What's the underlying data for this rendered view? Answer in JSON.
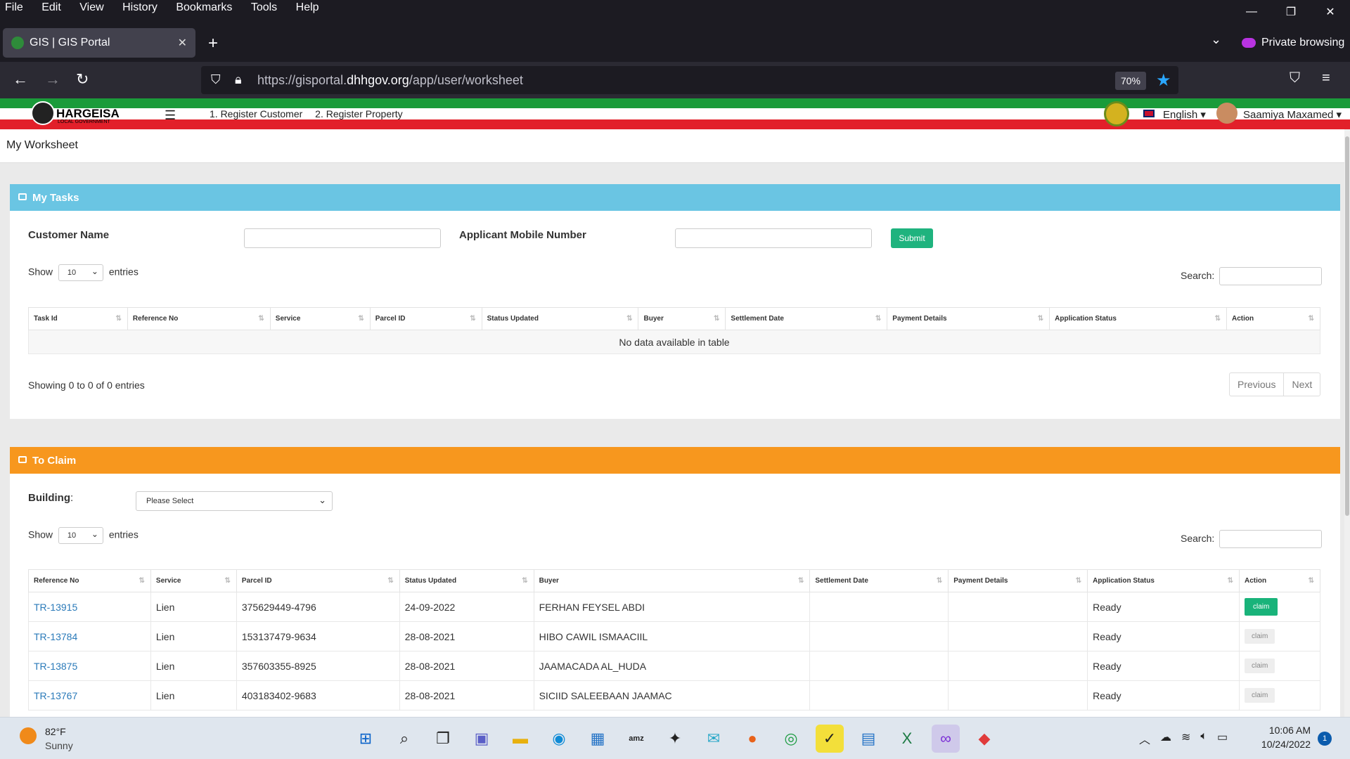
{
  "browser": {
    "menu": [
      "File",
      "Edit",
      "View",
      "History",
      "Bookmarks",
      "Tools",
      "Help"
    ],
    "tab_title": "GIS | GIS Portal",
    "private_label": "Private browsing",
    "url_prefix": "https://gisportal.",
    "url_domain": "dhhgov.org",
    "url_path": "/app/user/worksheet",
    "zoom": "70%"
  },
  "header": {
    "logo_text": "HARGEISA",
    "logo_sub": "LOCAL GOVERNMENT",
    "nav": [
      "1. Register Customer",
      "2. Register Property"
    ],
    "language": "English",
    "user": "Saamiya Maxamed"
  },
  "page_title": "My Worksheet",
  "my_tasks": {
    "title": "My Tasks",
    "header_color": "#6ac5e3",
    "customer_name_label": "Customer Name",
    "mobile_label": "Applicant Mobile Number",
    "submit": "Submit",
    "show": "Show",
    "entries": "entries",
    "page_length": "10",
    "search": "Search:",
    "columns": [
      "Task Id",
      "Reference No",
      "Service",
      "Parcel ID",
      "Status Updated",
      "Buyer",
      "Settlement Date",
      "Payment Details",
      "Application Status",
      "Action"
    ],
    "empty": "No data available in table",
    "info": "Showing 0 to 0 of 0 entries",
    "previous": "Previous",
    "next": "Next"
  },
  "to_claim": {
    "title": "To Claim",
    "header_color": "#f7971e",
    "building_label": "Building",
    "building_select": "Please Select",
    "show": "Show",
    "entries": "entries",
    "page_length": "10",
    "search": "Search:",
    "columns": [
      "Reference No",
      "Service",
      "Parcel ID",
      "Status Updated",
      "Buyer",
      "Settlement Date",
      "Payment Details",
      "Application Status",
      "Action"
    ],
    "rows": [
      {
        "ref": "TR-13915",
        "service": "Lien",
        "parcel": "375629449-4796",
        "updated": "24-09-2022",
        "buyer": "FERHAN FEYSEL ABDI",
        "settle": "",
        "payment": "",
        "status": "Ready",
        "action": "claim"
      },
      {
        "ref": "TR-13784",
        "service": "Lien",
        "parcel": "153137479-9634",
        "updated": "28-08-2021",
        "buyer": "HIBO CAWIL ISMAACIIL",
        "settle": "",
        "payment": "",
        "status": "Ready",
        "action": "claim"
      },
      {
        "ref": "TR-13875",
        "service": "Lien",
        "parcel": "357603355-8925",
        "updated": "28-08-2021",
        "buyer": "JAAMACADA AL_HUDA",
        "settle": "",
        "payment": "",
        "status": "Ready",
        "action": "claim"
      },
      {
        "ref": "TR-13767",
        "service": "Lien",
        "parcel": "403183402-9683",
        "updated": "28-08-2021",
        "buyer": "SICIID SALEEBAAN JAAMAC",
        "settle": "",
        "payment": "",
        "status": "Ready",
        "action": "claim"
      }
    ]
  },
  "taskbar": {
    "temp": "82°F",
    "condition": "Sunny",
    "time": "10:06 AM",
    "date": "10/24/2022",
    "notifications": "1"
  }
}
